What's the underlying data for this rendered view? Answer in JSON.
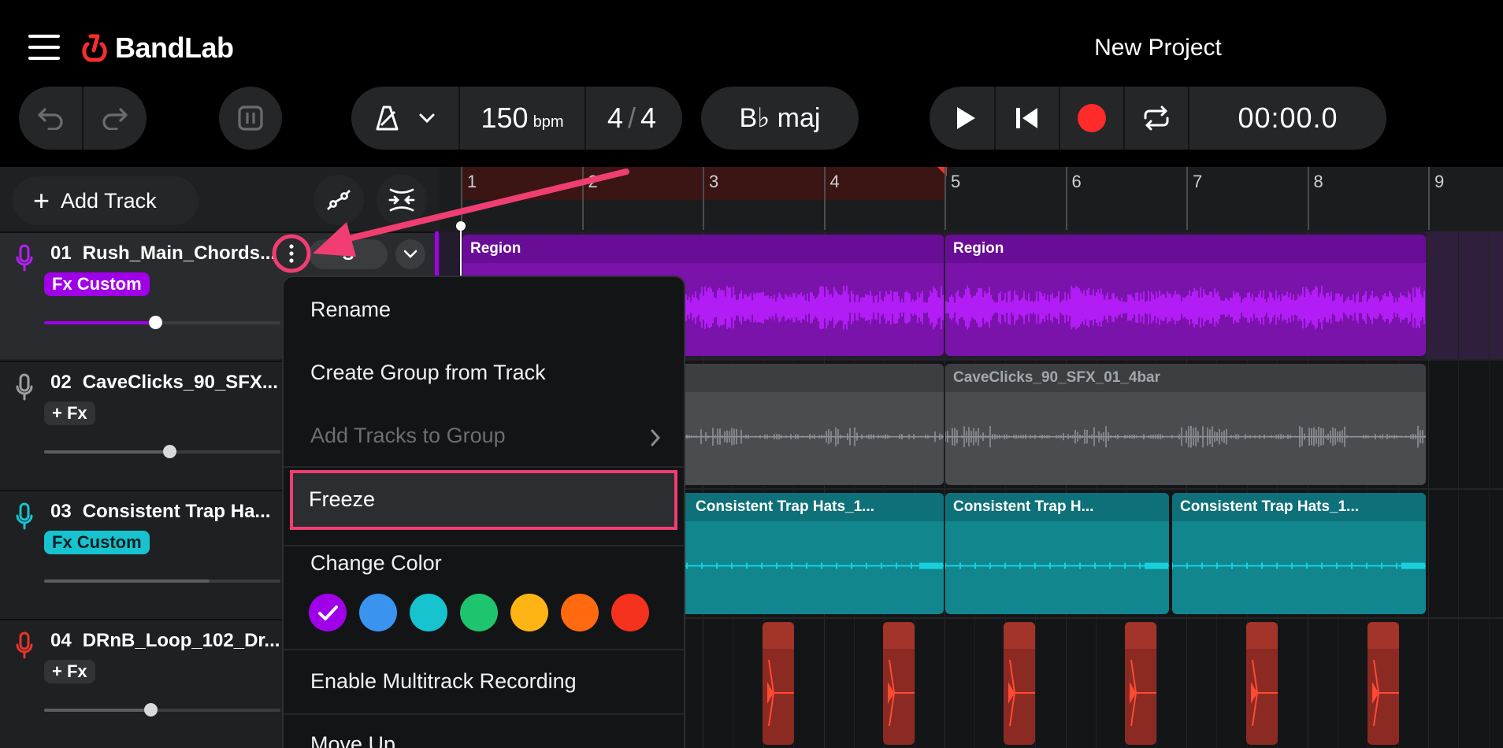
{
  "header": {
    "brand": "BandLab",
    "project_title": "New Project"
  },
  "toolbar": {
    "bpm_value": "150",
    "bpm_unit": "bpm",
    "time_sig_top": "4",
    "time_sig_bottom": "4",
    "key": "B♭ maj",
    "time": "00:00.0",
    "record_color": "#ff2a2a"
  },
  "track_controls": {
    "add_track_label": "Add Track",
    "solo_label": "S"
  },
  "ruler": {
    "bars": [
      "1",
      "2",
      "3",
      "4",
      "5",
      "6",
      "7",
      "8",
      "9"
    ]
  },
  "tracks": [
    {
      "number": "01",
      "name": "Rush_Main_Chords...",
      "fx": "Fx Custom",
      "color": "#a000e8",
      "volume": 0.47
    },
    {
      "number": "02",
      "name": "CaveClicks_90_SFX...",
      "fx": "+ Fx",
      "color": "#9a9ea3",
      "volume": 0.53
    },
    {
      "number": "03",
      "name": "Consistent Trap Ha...",
      "fx": "Fx Custom",
      "color": "#16c3cf",
      "volume": 0.7
    },
    {
      "number": "04",
      "name": "DRnB_Loop_102_Dr...",
      "fx": "+ Fx",
      "color": "#e8352a",
      "volume": 0.45
    }
  ],
  "regions": {
    "track1": [
      "Region",
      "Region"
    ],
    "track2": [
      "CaveClicks_90_SFX_01_4bar"
    ],
    "track3": [
      "Consistent Trap Hats_1...",
      "Consistent Trap H...",
      "Consistent Trap Hats_1..."
    ]
  },
  "context_menu": {
    "rename": "Rename",
    "create_group": "Create Group from Track",
    "add_to_group": "Add Tracks to Group",
    "freeze": "Freeze",
    "change_color": "Change Color",
    "enable_multitrack": "Enable Multitrack Recording",
    "move_up": "Move Up",
    "colors": [
      "#a000e8",
      "#3b93f0",
      "#16c3cf",
      "#1fc46e",
      "#ffb416",
      "#ff6a10",
      "#f5321e"
    ]
  },
  "highlight_color": "#f03e72"
}
